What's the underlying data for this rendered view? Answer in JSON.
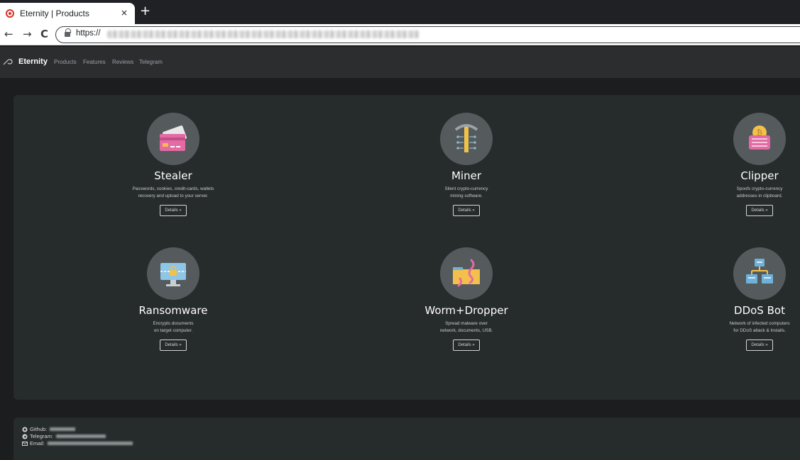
{
  "browser": {
    "tab_title": "Eternity | Products",
    "tab_close": "×",
    "new_tab": "+",
    "back": "←",
    "forward": "→",
    "reload": "C",
    "url": "https://"
  },
  "site": {
    "brand": "Eternity",
    "nav": [
      "Products",
      "Features",
      "Reviews",
      "Telegram"
    ]
  },
  "products": [
    {
      "icon": "credit-card-icon",
      "title": "Stealer",
      "desc_lines": [
        "Passwords, cookies, credit-cards, wallets",
        "recovery and upload to your server."
      ],
      "button": "Details »"
    },
    {
      "icon": "pickaxe-icon",
      "title": "Miner",
      "desc_lines": [
        "Silent crypto-currency",
        "mining software."
      ],
      "button": "Details »"
    },
    {
      "icon": "bitcoin-chip-icon",
      "title": "Clipper",
      "desc_lines": [
        "Spoofs crypto-currency",
        "addresses in clipboard."
      ],
      "button": "Details »"
    },
    {
      "icon": "locked-monitor-icon",
      "title": "Ransomware",
      "desc_lines": [
        "Encrypts documents",
        "on target computer."
      ],
      "button": "Details »"
    },
    {
      "icon": "worm-folder-icon",
      "title": "Worm+Dropper",
      "desc_lines": [
        "Spread malware over",
        "network, documents, USB."
      ],
      "button": "Details »"
    },
    {
      "icon": "network-bot-icon",
      "title": "DDoS Bot",
      "desc_lines": [
        "Network of infected computers",
        "for DDoS attack & Installs."
      ],
      "button": "Details »"
    }
  ],
  "footer": {
    "github_label": "Github:",
    "telegram_label": "Telegram:",
    "email_label": "Email:"
  }
}
